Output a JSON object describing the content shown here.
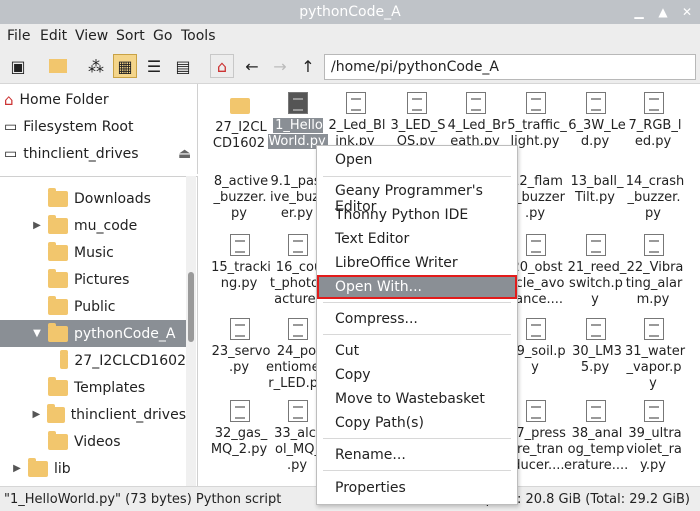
{
  "window": {
    "title": "pythonCode_A"
  },
  "menubar": [
    "File",
    "Edit",
    "View",
    "Sort",
    "Go",
    "Tools"
  ],
  "location": {
    "path": "/home/pi/pythonCode_A"
  },
  "places": [
    {
      "label": "Home Folder",
      "icon": "home-icon"
    },
    {
      "label": "Filesystem Root",
      "icon": "drive-icon"
    },
    {
      "label": "thinclient_drives",
      "icon": "drive-icon"
    }
  ],
  "tree": [
    {
      "label": "Downloads",
      "icon": "download-folder-icon"
    },
    {
      "label": "mu_code",
      "icon": "folder-icon"
    },
    {
      "label": "Music",
      "icon": "music-folder-icon"
    },
    {
      "label": "Pictures",
      "icon": "pictures-folder-icon"
    },
    {
      "label": "Public",
      "icon": "public-folder-icon"
    },
    {
      "label": "pythonCode_A",
      "icon": "folder-icon"
    },
    {
      "label": "27_I2CLCD1602",
      "icon": "folder-icon"
    },
    {
      "label": "Templates",
      "icon": "templates-folder-icon"
    },
    {
      "label": "thinclient_drives",
      "icon": "folder-icon"
    },
    {
      "label": "Videos",
      "icon": "videos-folder-icon"
    },
    {
      "label": "lib",
      "icon": "folder-icon"
    }
  ],
  "files": [
    [
      "27_I2CL\nCD1602",
      "1_Hello\nWorld.py",
      "2_Led_Bl\nink.py",
      "3_LED_S\nOS.py",
      "4_Led_Br\neath.py",
      "5_traffic_\nlight.py",
      "6_3W_Le\nd.py",
      "7_RGB_l\ned.py"
    ],
    [
      "8_active\n_buzzer.\npy",
      "9.1_pass\nive_buzz\ner.py",
      "",
      "",
      "12_flam\ne_buzzer\n.py",
      "13_ball_\nTilt.py",
      "14_crash\n_buzzer.\npy",
      ""
    ],
    [
      "15_tracki\nng.py",
      "16_cou\nt_photoc\nacture.",
      "",
      "",
      "20_obst\nacle_avo\ndance....",
      "21_reed_\nswitch.p\ny",
      "22_Vibra\nting_alar\nm.py",
      ""
    ],
    [
      "23_servo\n.py",
      "24_pot\nentiomete\nr_LED.py",
      "",
      "",
      "29_soil.p\ny",
      "30_LM3\n5.py",
      "31_water\n_vapor.p\ny",
      ""
    ],
    [
      "32_gas_\nMQ_2.py",
      "33_alco\nol_MQ_\n.py",
      "",
      "",
      "37_press\nure_tran\nsducer....",
      "38_anal\nog_temp\nerature....",
      "39_ultra\nviolet_ra\ny.py",
      ""
    ]
  ],
  "context_menu": {
    "open": "Open",
    "geany": "Geany Programmer's Editor",
    "thonny": "Thonny Python IDE",
    "text_editor": "Text Editor",
    "libreoffice": "LibreOffice Writer",
    "open_with": "Open With...",
    "compress": "Compress...",
    "cut": "Cut",
    "copy": "Copy",
    "trash": "Move to Wastebasket",
    "copy_path": "Copy Path(s)",
    "rename": "Rename...",
    "properties": "Properties"
  },
  "status": {
    "left": "\"1_HelloWorld.py\" (73 bytes) Python script",
    "right": "Free space: 20.8 GiB (Total: 29.2 GiB)"
  },
  "colors": {
    "selection": "#8a8f95",
    "highlight_border": "#e21b1b",
    "folder": "#f2c66d"
  }
}
